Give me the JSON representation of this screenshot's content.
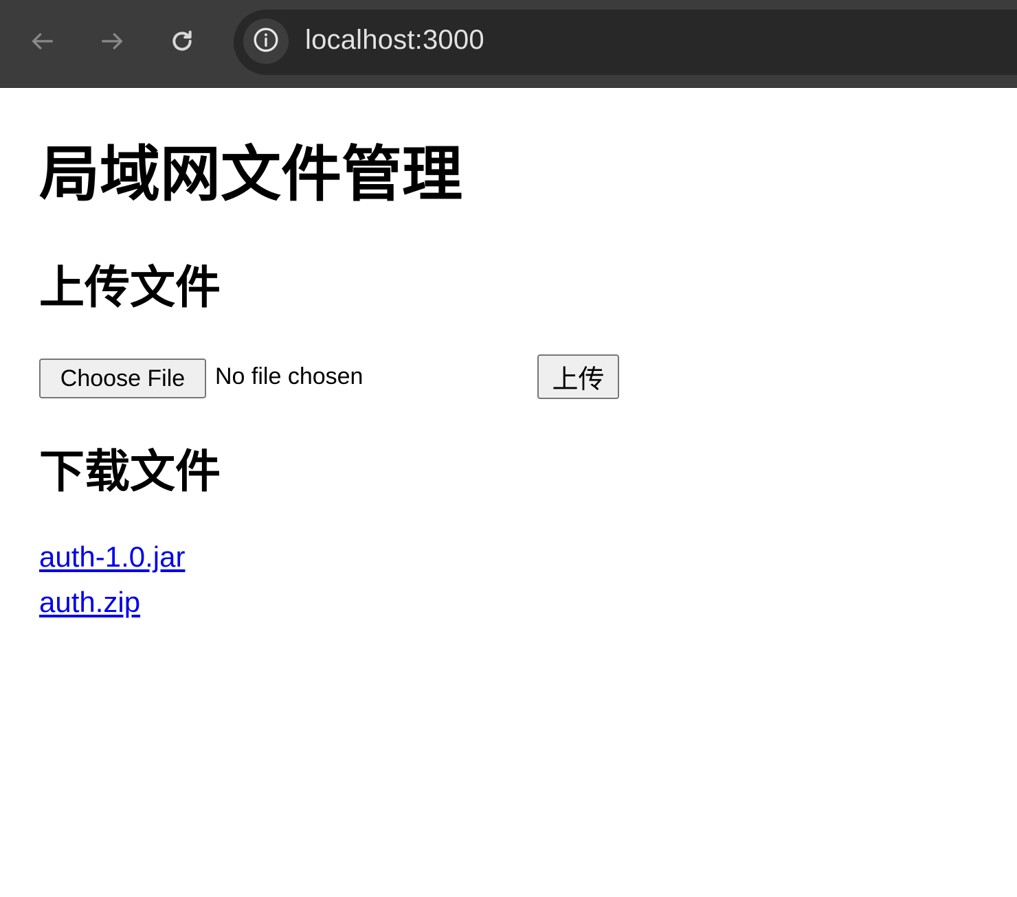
{
  "browser": {
    "back_icon": "arrow-left-icon",
    "forward_icon": "arrow-right-icon",
    "reload_icon": "reload-icon",
    "site_info_icon": "info-icon",
    "url": "localhost:3000"
  },
  "page": {
    "title": "局域网文件管理",
    "upload": {
      "heading": "上传文件",
      "choose_file_label": "Choose File",
      "file_status": "No file chosen",
      "submit_label": "上传"
    },
    "download": {
      "heading": "下载文件",
      "files": [
        {
          "name": "auth-1.0.jar"
        },
        {
          "name": "auth.zip"
        }
      ]
    }
  },
  "colors": {
    "chrome_bg": "#3c3c3c",
    "omnibox_bg": "#282828",
    "link": "#0000ee"
  }
}
